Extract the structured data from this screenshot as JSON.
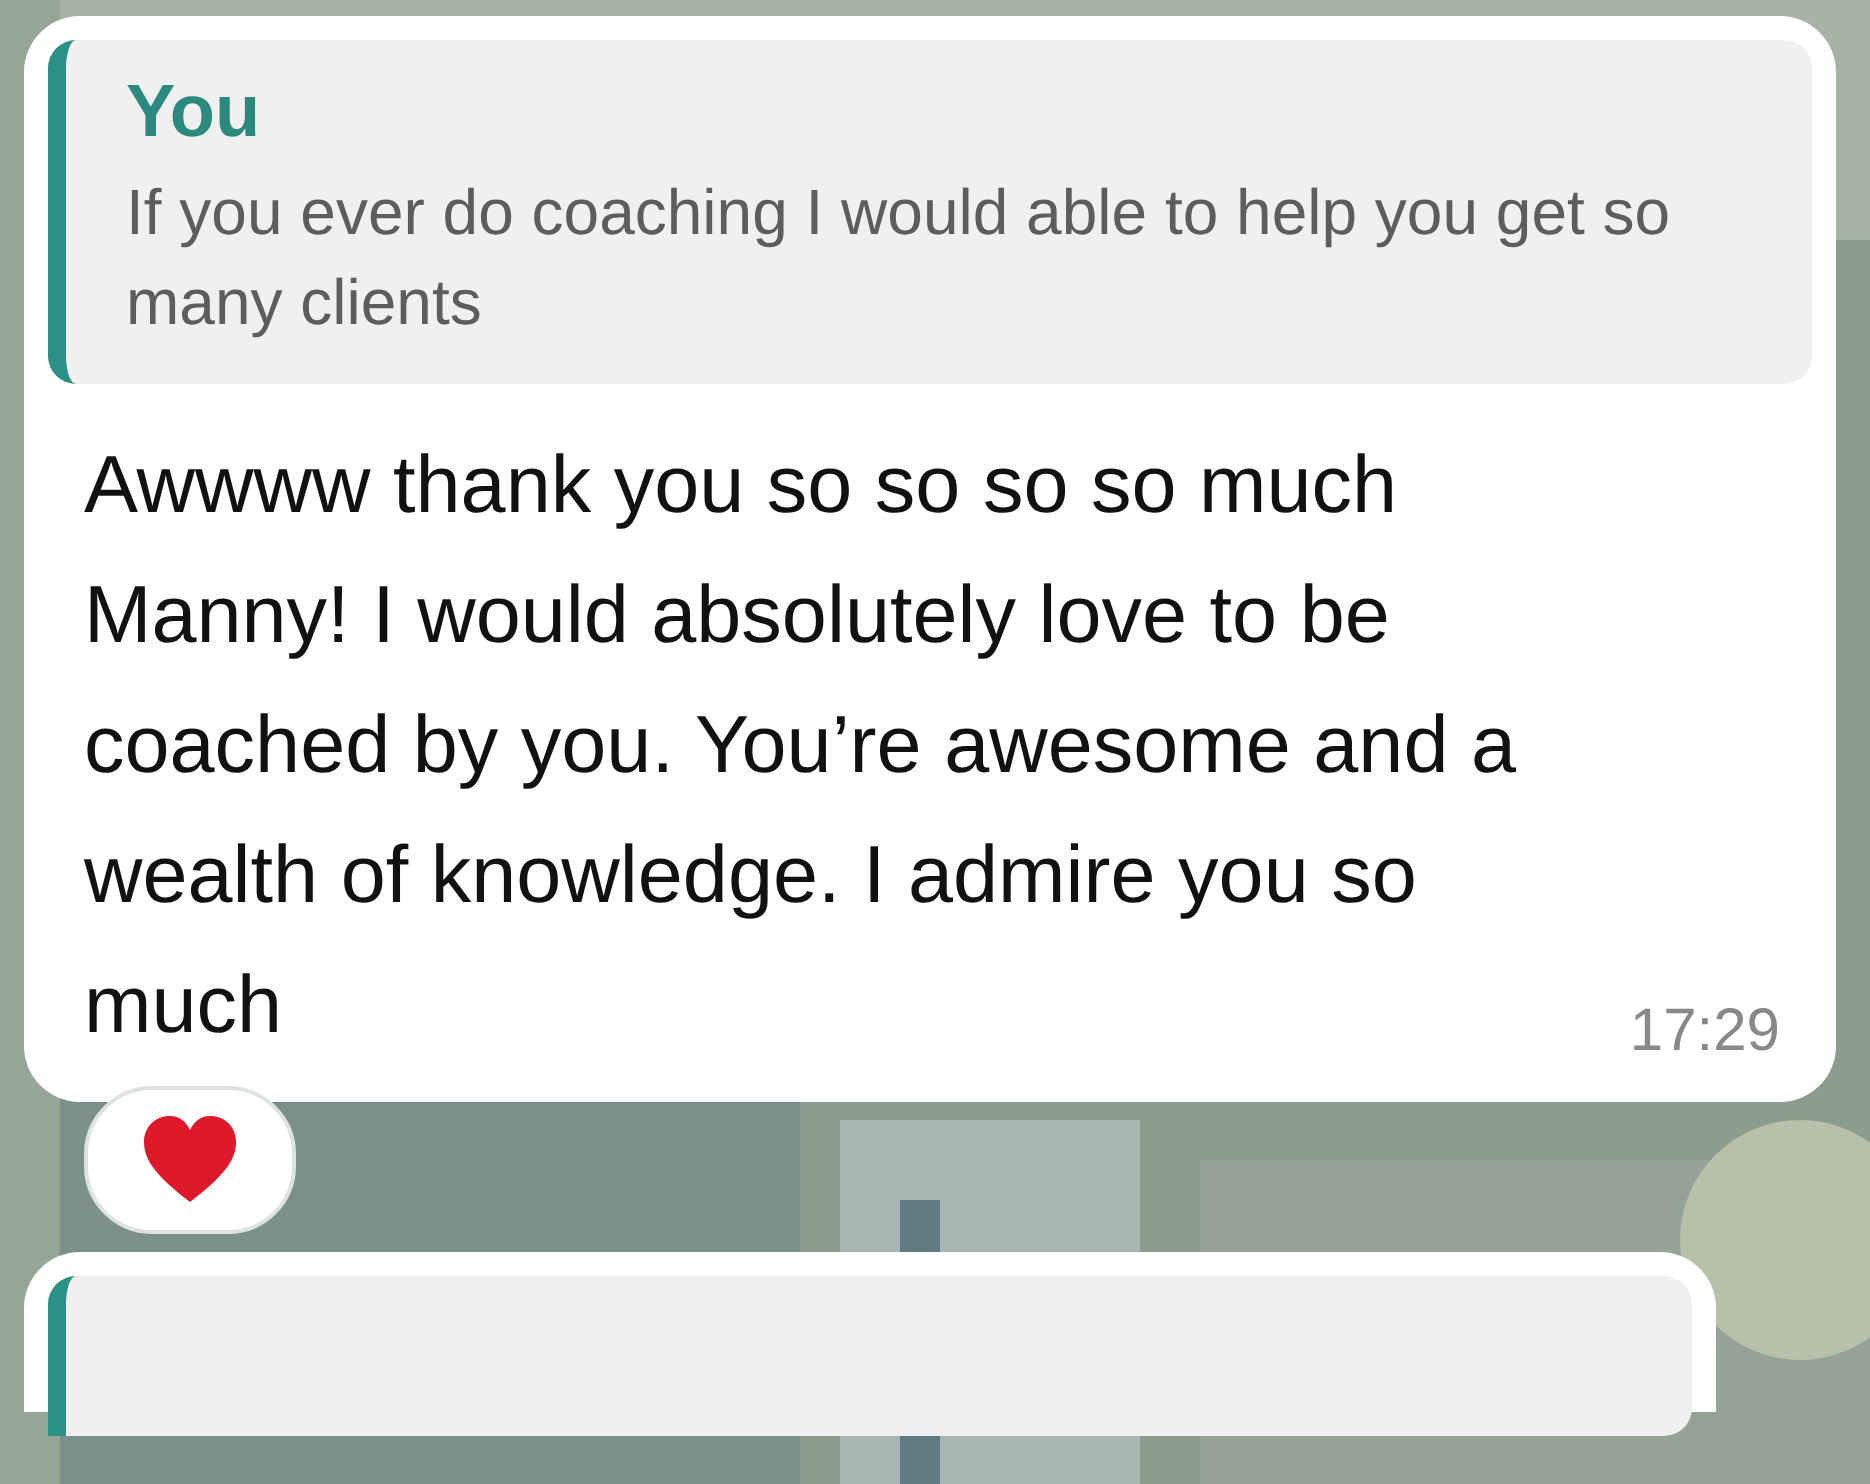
{
  "messages": [
    {
      "kind": "quoted-reply",
      "quote": {
        "author": "You",
        "text": "If you ever do coaching I would able to help you get so many clients"
      },
      "text": "Awwww thank you so so so so much Manny! I would absolutely love to be coached by you. You’re awesome and a wealth of knowledge. I admire you so much",
      "time": "17:29",
      "reacted": true
    },
    {
      "kind": "quoted-reply"
    }
  ]
}
